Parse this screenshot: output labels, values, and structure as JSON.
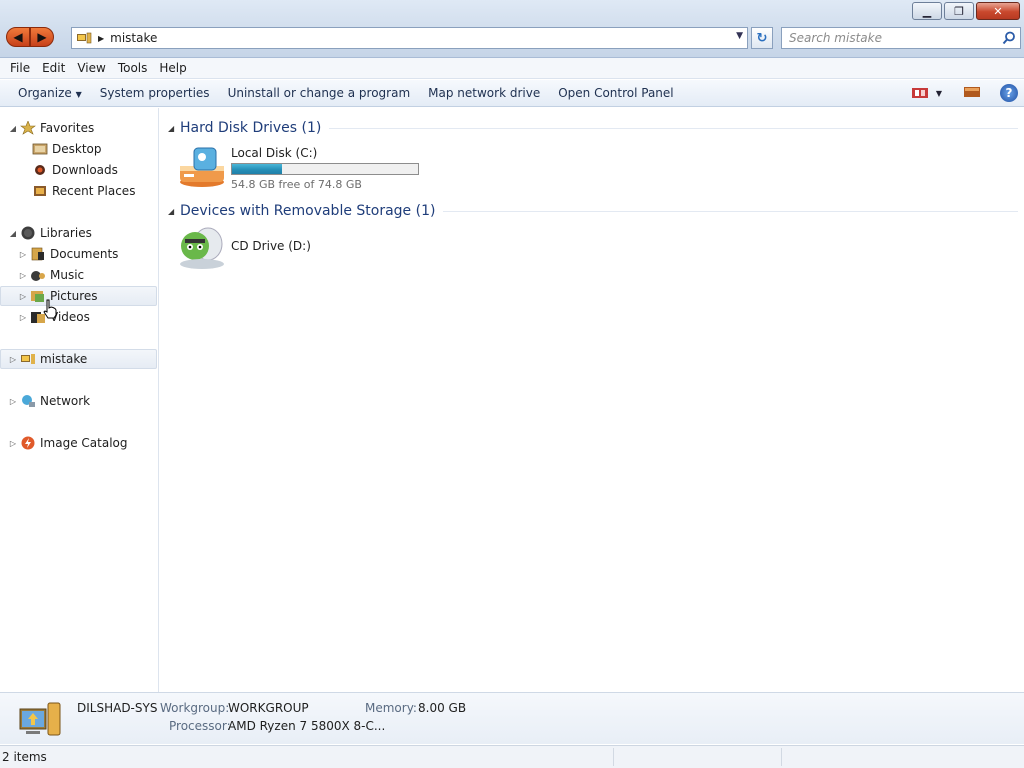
{
  "window": {
    "minimize": "▁",
    "maximize": "❐",
    "close": "✕"
  },
  "address": {
    "path": "mistake",
    "refresh": "↻"
  },
  "search": {
    "placeholder": "Search mistake"
  },
  "menu": [
    "File",
    "Edit",
    "View",
    "Tools",
    "Help"
  ],
  "toolbar": {
    "organize": "Organize",
    "items": [
      "System properties",
      "Uninstall or change a program",
      "Map network drive",
      "Open Control Panel"
    ],
    "help": "?"
  },
  "nav": {
    "favorites": {
      "label": "Favorites",
      "items": [
        "Desktop",
        "Downloads",
        "Recent Places"
      ]
    },
    "libraries": {
      "label": "Libraries",
      "items": [
        "Documents",
        "Music",
        "Pictures",
        "Videos"
      ]
    },
    "computer": "mistake",
    "network": "Network",
    "catalog": "Image Catalog"
  },
  "groups": [
    {
      "title": "Hard Disk Drives (1)"
    },
    {
      "title": "Devices with Removable Storage (1)"
    }
  ],
  "drives": [
    {
      "name": "Local Disk (C:)",
      "free_text": "54.8 GB free of 74.8 GB",
      "used_fraction": 0.267
    },
    {
      "name": "CD Drive (D:)"
    }
  ],
  "details": {
    "computer_name": "DILSHAD-SYS",
    "workgroup_label": "Workgroup:",
    "workgroup": "WORKGROUP",
    "memory_label": "Memory:",
    "memory": "8.00 GB",
    "processor_label": "Processor:",
    "processor": "AMD Ryzen 7 5800X 8-C..."
  },
  "status": {
    "items": "2 items"
  },
  "colors": {
    "accent": "#1f3d7a",
    "bar_fill": "#2690b8",
    "nav_arrows": "#e2622c"
  }
}
